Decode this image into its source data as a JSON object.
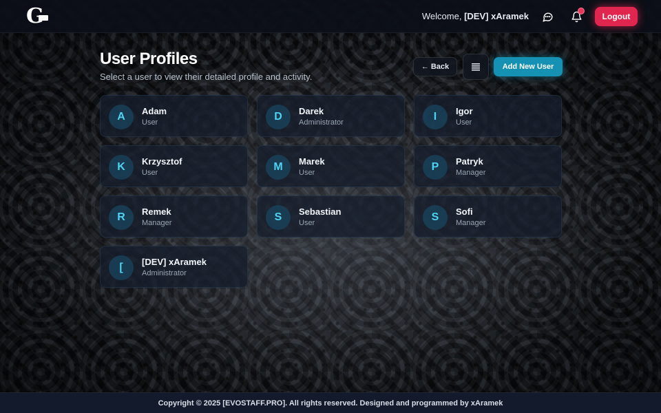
{
  "header": {
    "logo_text": "G",
    "welcome_prefix": "Welcome,",
    "username": "[DEV] xAramek",
    "icons": {
      "chat": "chat-bubble-icon",
      "bell": "bell-icon"
    },
    "logout_label": "Logout"
  },
  "page": {
    "title": "User Profiles",
    "subtitle": "Select a user to view their detailed profile and activity.",
    "back_arrow": "←",
    "back_label": "Back",
    "menu_icon": "list-icon",
    "add_label": "Add New User"
  },
  "users": [
    {
      "initial": "A",
      "name": "Adam",
      "role": "User"
    },
    {
      "initial": "D",
      "name": "Darek",
      "role": "Administrator"
    },
    {
      "initial": "I",
      "name": "Igor",
      "role": "User"
    },
    {
      "initial": "K",
      "name": "Krzysztof",
      "role": "User"
    },
    {
      "initial": "M",
      "name": "Marek",
      "role": "User"
    },
    {
      "initial": "P",
      "name": "Patryk",
      "role": "Manager"
    },
    {
      "initial": "R",
      "name": "Remek",
      "role": "Manager"
    },
    {
      "initial": "S",
      "name": "Sebastian",
      "role": "User"
    },
    {
      "initial": "S",
      "name": "Sofi",
      "role": "Manager"
    },
    {
      "initial": "[",
      "name": "[DEV] xAramek",
      "role": "Administrator"
    }
  ],
  "footer": {
    "text": "Copyright © 2025 [EVOSTAFF.PRO]. All rights reserved. Designed and programmed by xAramek"
  },
  "colors": {
    "accent": "#1591b3",
    "logout": "#e0264f",
    "avatar_text": "#4fd3f2",
    "notification": "#e9365a"
  }
}
